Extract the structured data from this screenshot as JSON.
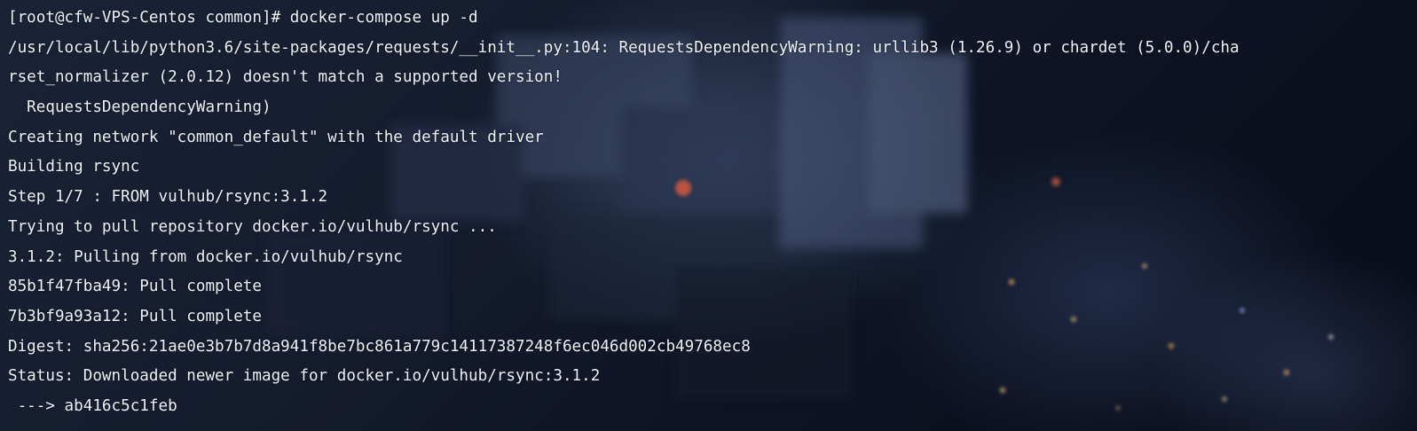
{
  "terminal": {
    "lines": [
      "[root@cfw-VPS-Centos common]# docker-compose up -d",
      "/usr/local/lib/python3.6/site-packages/requests/__init__.py:104: RequestsDependencyWarning: urllib3 (1.26.9) or chardet (5.0.0)/cha",
      "rset_normalizer (2.0.12) doesn't match a supported version!",
      "  RequestsDependencyWarning)",
      "Creating network \"common_default\" with the default driver",
      "Building rsync",
      "Step 1/7 : FROM vulhub/rsync:3.1.2",
      "Trying to pull repository docker.io/vulhub/rsync ...",
      "3.1.2: Pulling from docker.io/vulhub/rsync",
      "85b1f47fba49: Pull complete",
      "7b3bf9a93a12: Pull complete",
      "Digest: sha256:21ae0e3b7b7d8a941f8be7bc861a779c14117387248f6ec046d002cb49768ec8",
      "Status: Downloaded newer image for docker.io/vulhub/rsync:3.1.2",
      " ---> ab416c5c1feb"
    ]
  }
}
